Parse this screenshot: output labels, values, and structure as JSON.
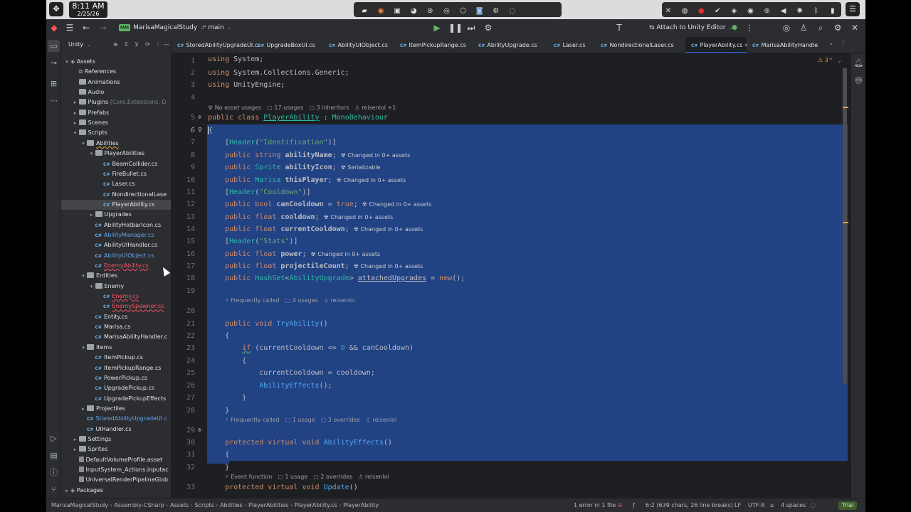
{
  "system": {
    "time": "8:11 AM",
    "date": "2/25/26"
  },
  "ide": {
    "project_name": "MarisaMagicalStudy",
    "project_badge": "MM",
    "branch": "main",
    "attach_label": "Attach to Unity Editor",
    "panel_title": "Unity"
  },
  "tree": [
    {
      "label": "Assets",
      "depth": 0,
      "arrow": "open",
      "kind": "unity"
    },
    {
      "label": "References",
      "depth": 1,
      "arrow": "",
      "kind": "ref"
    },
    {
      "label": "Animations",
      "depth": 1,
      "arrow": "",
      "kind": "folder"
    },
    {
      "label": "Audio",
      "depth": 1,
      "arrow": "",
      "kind": "folder"
    },
    {
      "label": "Plugins",
      "depth": 1,
      "arrow": "closed",
      "kind": "folder",
      "extra": "(Core.Extensions, D"
    },
    {
      "label": "Prefabs",
      "depth": 1,
      "arrow": "closed",
      "kind": "folder"
    },
    {
      "label": "Scenes",
      "depth": 1,
      "arrow": "closed",
      "kind": "folder"
    },
    {
      "label": "Scripts",
      "depth": 1,
      "arrow": "open",
      "kind": "folder"
    },
    {
      "label": "Abilities",
      "depth": 2,
      "arrow": "open",
      "kind": "folder",
      "style": "underline"
    },
    {
      "label": "PlayerAbilities",
      "depth": 3,
      "arrow": "open",
      "kind": "folder"
    },
    {
      "label": "BeamCollider.cs",
      "depth": 4,
      "arrow": "",
      "kind": "cs"
    },
    {
      "label": "FireBullet.cs",
      "depth": 4,
      "arrow": "",
      "kind": "cs"
    },
    {
      "label": "Laser.cs",
      "depth": 4,
      "arrow": "",
      "kind": "cs"
    },
    {
      "label": "NondirectionalLase",
      "depth": 4,
      "arrow": "",
      "kind": "cs"
    },
    {
      "label": "PlayerAbility.cs",
      "depth": 4,
      "arrow": "",
      "kind": "cs",
      "selected": true
    },
    {
      "label": "Upgrades",
      "depth": 3,
      "arrow": "closed",
      "kind": "folder"
    },
    {
      "label": "AbilityHotbarIcon.cs",
      "depth": 3,
      "arrow": "",
      "kind": "cs"
    },
    {
      "label": "AbilityManager.cs",
      "depth": 3,
      "arrow": "",
      "kind": "cs",
      "style": "mod"
    },
    {
      "label": "AbilityUIHandler.cs",
      "depth": 3,
      "arrow": "",
      "kind": "cs"
    },
    {
      "label": "AbilityUIObject.cs",
      "depth": 3,
      "arrow": "",
      "kind": "cs",
      "style": "mod"
    },
    {
      "label": "EnemyAbility.cs",
      "depth": 3,
      "arrow": "",
      "kind": "cs",
      "style": "err"
    },
    {
      "label": "Entities",
      "depth": 2,
      "arrow": "open",
      "kind": "folder"
    },
    {
      "label": "Enemy",
      "depth": 3,
      "arrow": "open",
      "kind": "folder"
    },
    {
      "label": "Enemy.cs",
      "depth": 4,
      "arrow": "",
      "kind": "cs",
      "style": "err"
    },
    {
      "label": "EnemySpawner.cs",
      "depth": 4,
      "arrow": "",
      "kind": "cs",
      "style": "err"
    },
    {
      "label": "Entity.cs",
      "depth": 3,
      "arrow": "",
      "kind": "cs"
    },
    {
      "label": "Marisa.cs",
      "depth": 3,
      "arrow": "",
      "kind": "cs"
    },
    {
      "label": "MarisaAbilityHandler.c",
      "depth": 3,
      "arrow": "",
      "kind": "cs"
    },
    {
      "label": "Items",
      "depth": 2,
      "arrow": "open",
      "kind": "folder"
    },
    {
      "label": "ItemPickup.cs",
      "depth": 3,
      "arrow": "",
      "kind": "cs"
    },
    {
      "label": "ItemPickupRange.cs",
      "depth": 3,
      "arrow": "",
      "kind": "cs"
    },
    {
      "label": "PowerPickup.cs",
      "depth": 3,
      "arrow": "",
      "kind": "cs"
    },
    {
      "label": "UpgradePickup.cs",
      "depth": 3,
      "arrow": "",
      "kind": "cs"
    },
    {
      "label": "UpgradePickupEffects",
      "depth": 3,
      "arrow": "",
      "kind": "cs"
    },
    {
      "label": "Projectiles",
      "depth": 2,
      "arrow": "closed",
      "kind": "folder"
    },
    {
      "label": "StoredAbilityUpgradeUI.c",
      "depth": 2,
      "arrow": "",
      "kind": "cs",
      "style": "mod"
    },
    {
      "label": "UIHandler.cs",
      "depth": 2,
      "arrow": "",
      "kind": "cs"
    },
    {
      "label": "Settings",
      "depth": 1,
      "arrow": "closed",
      "kind": "folder"
    },
    {
      "label": "Sprites",
      "depth": 1,
      "arrow": "closed",
      "kind": "folder"
    },
    {
      "label": "DefaultVolumeProfile.asset",
      "depth": 1,
      "arrow": "",
      "kind": "asset"
    },
    {
      "label": "InputSystem_Actions.inputac",
      "depth": 1,
      "arrow": "",
      "kind": "asset"
    },
    {
      "label": "UniversalRenderPipelineGlob",
      "depth": 1,
      "arrow": "",
      "kind": "asset"
    },
    {
      "label": "Packages",
      "depth": 0,
      "arrow": "closed",
      "kind": "unity"
    }
  ],
  "tabs": [
    {
      "label": "StoredAbilityUpgradeUI.cs",
      "active": false
    },
    {
      "label": "UpgradeBoxUI.cs",
      "active": false
    },
    {
      "label": "AbilityUIObject.cs",
      "active": false
    },
    {
      "label": "ItemPickupRange.cs",
      "active": false
    },
    {
      "label": "AbilityUpgrade.cs",
      "active": false
    },
    {
      "label": "Laser.cs",
      "active": false
    },
    {
      "label": "NondirectionalLaser.cs",
      "active": false
    },
    {
      "label": "PlayerAbility.cs",
      "active": true
    },
    {
      "label": "MarisaAbilityHandle",
      "active": false
    }
  ],
  "editor": {
    "warnings_count": "3",
    "line_numbers": [
      "1",
      "2",
      "3",
      "4",
      "5",
      "6",
      "7",
      "8",
      "9",
      "10",
      "11",
      "12",
      "13",
      "14",
      "15",
      "16",
      "17",
      "18",
      "19",
      "20",
      "21",
      "22",
      "23",
      "24",
      "25",
      "26",
      "27",
      "28",
      "29",
      "30",
      "31",
      "32",
      "33"
    ],
    "hints": {
      "class": [
        "No asset usages",
        "17 usages",
        "3 inheritors",
        "reisenlol +1"
      ],
      "try_ability": [
        "Frequently called",
        "4 usages",
        "reisenlol"
      ],
      "ability_effects": [
        "Frequently called",
        "1 usage",
        "3 overrides",
        "reisenlol"
      ],
      "update": [
        "Event function",
        "1 usage",
        "2 overrides",
        "reisenlol"
      ]
    },
    "inline": {
      "changed": "Changed in 0+ assets",
      "serializable": "Serializable"
    }
  },
  "status": {
    "breadcrumb": [
      "MarisaMagicalStudy",
      "Assembly-CSharp",
      "Assets",
      "Scripts",
      "Abilities",
      "PlayerAbilities",
      "PlayerAbility.cs",
      "PlayerAbility"
    ],
    "errors": "1 error in 1 file",
    "position": "6:2 (639 chars, 26 line breaks)",
    "line_sep": "LF",
    "encoding": "UTF-8",
    "indent": "4 spaces",
    "license": "Trial"
  }
}
